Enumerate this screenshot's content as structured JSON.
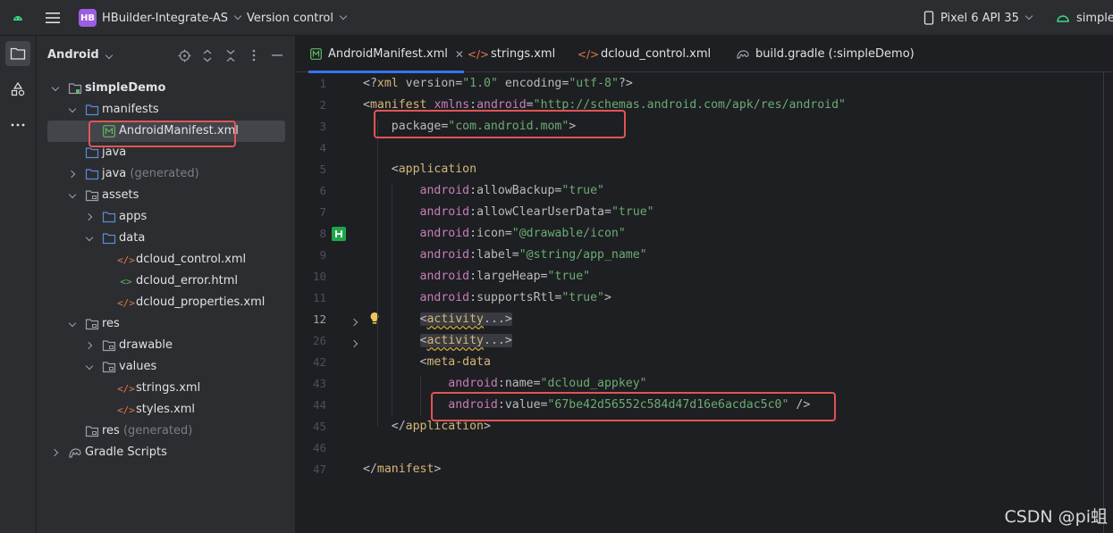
{
  "topbar": {
    "project_badge": "HB",
    "project_name": "HBuilder-Integrate-AS",
    "vcs_label": "Version control",
    "device_label": "Pixel 6 API 35",
    "run_config_label": "simpleDe"
  },
  "project_panel": {
    "title": "Android",
    "tree": [
      {
        "label": "simpleDemo",
        "suffix": "",
        "icon": "module-folder-icon",
        "arrow": "down",
        "bold": true
      },
      {
        "label": "manifests",
        "suffix": "",
        "icon": "folder-icon",
        "arrow": "down"
      },
      {
        "label": "AndroidManifest.xml",
        "suffix": "",
        "icon": "manifest-file-icon",
        "arrow": "",
        "selected": true
      },
      {
        "label": "java",
        "suffix": "",
        "icon": "folder-icon",
        "arrow": ""
      },
      {
        "label": "java",
        "suffix": " (generated)",
        "icon": "folder-icon",
        "arrow": "right"
      },
      {
        "label": "assets",
        "suffix": "",
        "icon": "res-folder-icon",
        "arrow": "down"
      },
      {
        "label": "apps",
        "suffix": "",
        "icon": "folder-icon",
        "arrow": "right"
      },
      {
        "label": "data",
        "suffix": "",
        "icon": "folder-icon",
        "arrow": "down"
      },
      {
        "label": "dcloud_control.xml",
        "suffix": "",
        "icon": "xml-file-icon",
        "arrow": ""
      },
      {
        "label": "dcloud_error.html",
        "suffix": "",
        "icon": "html-file-icon",
        "arrow": ""
      },
      {
        "label": "dcloud_properties.xml",
        "suffix": "",
        "icon": "xml-file-icon",
        "arrow": ""
      },
      {
        "label": "res",
        "suffix": "",
        "icon": "res-folder-icon",
        "arrow": "down"
      },
      {
        "label": "drawable",
        "suffix": "",
        "icon": "res-folder-icon",
        "arrow": "right"
      },
      {
        "label": "values",
        "suffix": "",
        "icon": "res-folder-icon",
        "arrow": "down"
      },
      {
        "label": "strings.xml",
        "suffix": "",
        "icon": "xml-file-icon",
        "arrow": ""
      },
      {
        "label": "styles.xml",
        "suffix": "",
        "icon": "xml-file-icon",
        "arrow": ""
      },
      {
        "label": "res",
        "suffix": " (generated)",
        "icon": "res-folder-icon",
        "arrow": ""
      },
      {
        "label": "Gradle Scripts",
        "suffix": "",
        "icon": "gradle-icon",
        "arrow": "right"
      }
    ]
  },
  "editor": {
    "tabs": [
      {
        "label": "AndroidManifest.xml",
        "icon": "manifest-file-icon",
        "active": true,
        "close": "✕"
      },
      {
        "label": "strings.xml",
        "icon": "xml-file-icon",
        "active": false
      },
      {
        "label": "dcloud_control.xml",
        "icon": "xml-file-icon",
        "active": false
      },
      {
        "label": "build.gradle (:simpleDemo)",
        "icon": "gradle-icon",
        "active": false
      }
    ],
    "line_numbers": [
      "1",
      "2",
      "3",
      "4",
      "5",
      "6",
      "7",
      "8",
      "9",
      "10",
      "11",
      "12",
      "26",
      "42",
      "43",
      "44",
      "45",
      "46",
      "47"
    ],
    "current_line": "12"
  },
  "watermark": "CSDN @pi蛆"
}
